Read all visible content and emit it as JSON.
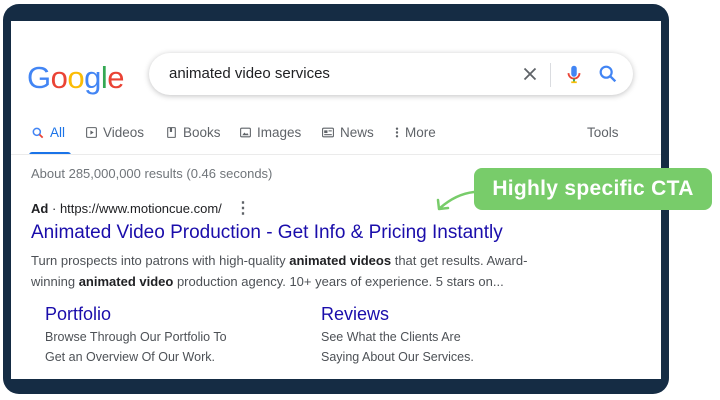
{
  "logo": {
    "letters": [
      "G",
      "o",
      "o",
      "g",
      "l",
      "e"
    ],
    "colors": [
      "#4285f4",
      "#ea4335",
      "#fbbc05",
      "#4285f4",
      "#34a853",
      "#ea4335"
    ]
  },
  "search": {
    "query": "animated video services"
  },
  "icons": {
    "clear": "close-icon",
    "voice": "mic-icon",
    "search": "search-icon"
  },
  "tabs": [
    {
      "label": "All",
      "icon": "search-icon",
      "active": true
    },
    {
      "label": "Videos",
      "icon": "play-icon"
    },
    {
      "label": "Books",
      "icon": "book-icon"
    },
    {
      "label": "Images",
      "icon": "image-icon"
    },
    {
      "label": "News",
      "icon": "news-icon"
    },
    {
      "label": "More",
      "icon": "vertical-dots-icon"
    },
    {
      "label": "Tools"
    }
  ],
  "stats": "About 285,000,000 results (0.46 seconds)",
  "ad": {
    "badge": "Ad",
    "separator": "·",
    "url": "https://www.motioncue.com/",
    "title": "Animated Video Production - Get Info & Pricing Instantly",
    "desc_parts": [
      "Turn prospects into patrons with high-quality ",
      "animated videos",
      " that get results. Award-winning ",
      "animated video",
      " production agency. 10+ years of experience. 5 stars on..."
    ]
  },
  "sitelinks": [
    {
      "title": "Portfolio",
      "line1": "Browse Through Our Portfolio To",
      "line2": "Get an Overview Of Our Work."
    },
    {
      "title": "Reviews",
      "line1": "See What the Clients Are",
      "line2": "Saying About Our Services."
    }
  ],
  "callout": {
    "text": "Highly specific CTA",
    "color": "#78cc6a"
  },
  "colors": {
    "frame": "#152c44",
    "link": "#1a0dab",
    "accent": "#1a73e8"
  }
}
